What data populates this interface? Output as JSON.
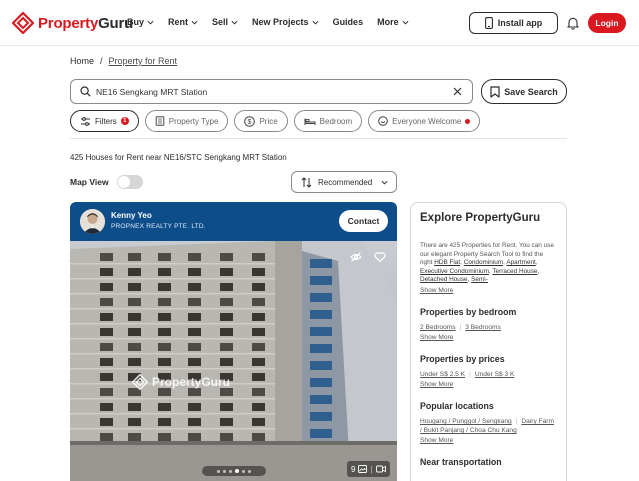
{
  "header": {
    "logo_text_a": "Property",
    "logo_text_b": "Guru",
    "nav": [
      "Buy",
      "Rent",
      "Sell",
      "New Projects",
      "Guides",
      "More"
    ],
    "install_label": "Install app",
    "login_label": "Login"
  },
  "breadcrumb": {
    "home": "Home",
    "separator": "/",
    "current": "Property for Rent"
  },
  "search": {
    "value": "NE16 Sengkang MRT Station",
    "save_label": "Save Search"
  },
  "filters": {
    "filters_label": "Filters",
    "filters_count": "1",
    "property_type": "Property Type",
    "price": "Price",
    "bedroom": "Bedroom",
    "everyone_welcome": "Everyone Welcome"
  },
  "results": {
    "count_text": "425 Houses for Rent near NE16/STC Sengkang MRT Station"
  },
  "map_view": {
    "label": "Map View"
  },
  "sort": {
    "label": "Recommended"
  },
  "listing": {
    "agent_name": "Kenny Yeo",
    "agency": "PROPNEX REALTY PTE. LTD.",
    "contact_label": "Contact",
    "watermark": "PropertyGuru",
    "photo_count": "9",
    "current_photo_index": 4,
    "total_dots": 6
  },
  "explore": {
    "title": "Explore PropertyGuru",
    "intro_prefix": "There are 425 Properties for Rent. You can use our elegant Property Search Tool to find the right ",
    "intro_links": [
      "HDB Flat",
      "Condominium",
      "Apartment",
      "Executive Condominium",
      "Terraced House",
      "Detached House",
      "Semi-"
    ],
    "show_more": "Show More",
    "bedroom_title": "Properties by bedroom",
    "bedroom_links": [
      "2 Bedrooms",
      "3 Bedrooms"
    ],
    "prices_title": "Properties by prices",
    "price_links": [
      "Under S$ 2.5 K",
      "Under S$ 3 K"
    ],
    "locations_title": "Popular locations",
    "location_links": [
      "Hougang / Punggol / Sengkang",
      "Dairy Farm / Bukit Panjang / Choa Chu Kang"
    ],
    "transport_title": "Near transportation"
  },
  "colors": {
    "brand_red": "#d9191f",
    "agent_bar": "#0d4d8a",
    "text": "#2c2c2c"
  }
}
